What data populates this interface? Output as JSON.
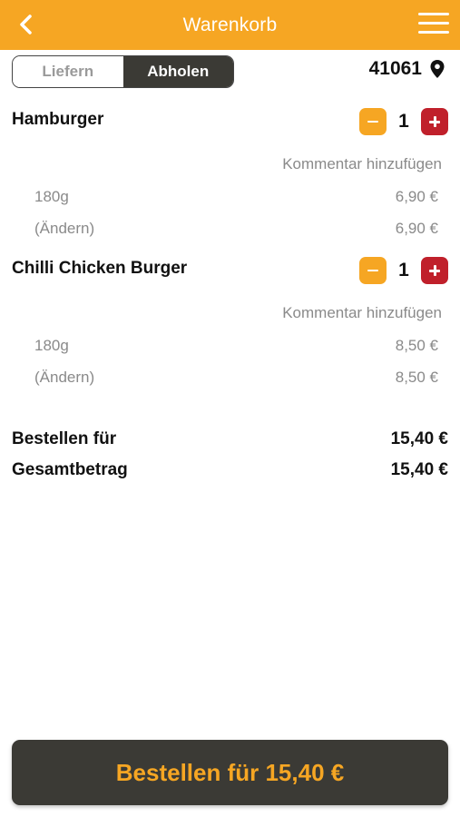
{
  "colors": {
    "accent": "#f6a623",
    "dark": "#3b3a35",
    "plus": "#c0202b",
    "muted": "#8a8a8a"
  },
  "header": {
    "title": "Warenkorb",
    "back_icon": "chevron-left-icon",
    "menu_icon": "hamburger-menu-icon"
  },
  "mode_toggle": {
    "options": [
      "Liefern",
      "Abholen"
    ],
    "selected": "Abholen"
  },
  "postal_code": {
    "value": "41061",
    "icon": "map-pin-icon"
  },
  "cart": {
    "items": [
      {
        "name": "Hamburger",
        "quantity": "1",
        "comment_label": "Kommentar hinzufügen",
        "lines": [
          {
            "label": "180g",
            "price": "6,90 €"
          },
          {
            "label": "(Ändern)",
            "price": "6,90 €"
          }
        ]
      },
      {
        "name": "Chilli Chicken Burger",
        "quantity": "1",
        "comment_label": "Kommentar hinzufügen",
        "lines": [
          {
            "label": "180g",
            "price": "8,50 €"
          },
          {
            "label": "(Ändern)",
            "price": "8,50 €"
          }
        ]
      }
    ]
  },
  "summary": {
    "order_for_label": "Bestellen für",
    "order_for_value": "15,40 €",
    "total_label": "Gesamtbetrag",
    "total_value": "15,40 €"
  },
  "footer": {
    "order_button_label": "Bestellen für 15,40 €"
  }
}
